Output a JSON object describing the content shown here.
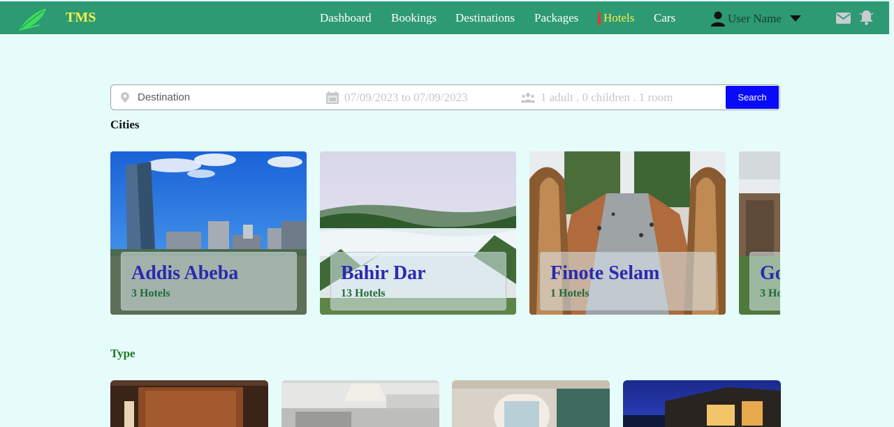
{
  "brand": {
    "name": "TMS"
  },
  "nav": {
    "items": [
      {
        "label": "Dashboard"
      },
      {
        "label": "Bookings"
      },
      {
        "label": "Destinations"
      },
      {
        "label": "Packages"
      },
      {
        "label": "Hotels",
        "active": true
      },
      {
        "label": "Cars"
      }
    ],
    "user_name": "User Name"
  },
  "search": {
    "destination_placeholder": "Destination",
    "dates": "07/09/2023 to 07/09/2023",
    "guests": "1 adult . 0 children . 1 room",
    "button_label": "Search"
  },
  "cities": {
    "title": "Cities",
    "items": [
      {
        "name": "Addis Abeba",
        "count": "3 Hotels"
      },
      {
        "name": "Bahir Dar",
        "count": "13 Hotels"
      },
      {
        "name": "Finote Selam",
        "count": "1 Hotels"
      },
      {
        "name": "Go",
        "count": "3 Ho"
      }
    ]
  },
  "types": {
    "title": "Type"
  },
  "colors": {
    "navbar": "#2d9a73",
    "brand": "#f7f24a",
    "active_nav": "#f7f24a",
    "search_button": "#0a0afa",
    "city_name": "#2a2ab0",
    "city_count": "#1f6b3a",
    "type_title": "#1f7a1f",
    "page_background": "#e6fcfb"
  },
  "icons": [
    "logo-leaf-icon",
    "user-icon",
    "caret-down-icon",
    "mail-icon",
    "bell-icon",
    "location-pin-icon",
    "calendar-icon",
    "people-icon"
  ]
}
